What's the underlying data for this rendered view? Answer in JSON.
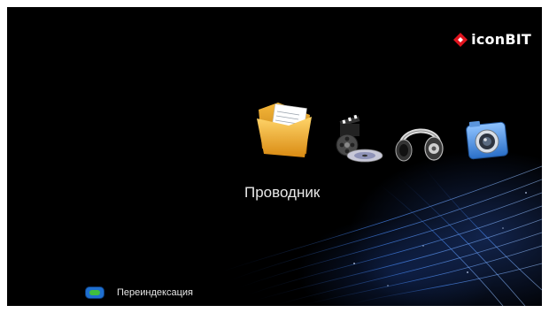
{
  "brand": {
    "name": "iconBIT",
    "accent_color": "#e0141e"
  },
  "menu": {
    "items": [
      {
        "icon": "folder-icon",
        "label": "Проводник",
        "selected": true
      },
      {
        "icon": "movie-icon",
        "selected": false
      },
      {
        "icon": "headphones-icon",
        "selected": false
      },
      {
        "icon": "camera-icon",
        "selected": false
      }
    ],
    "selected_label": "Проводник"
  },
  "hint": {
    "key_icon": "green-button-icon",
    "key_color": "#3fbf3f",
    "label": "Переиндексация"
  }
}
